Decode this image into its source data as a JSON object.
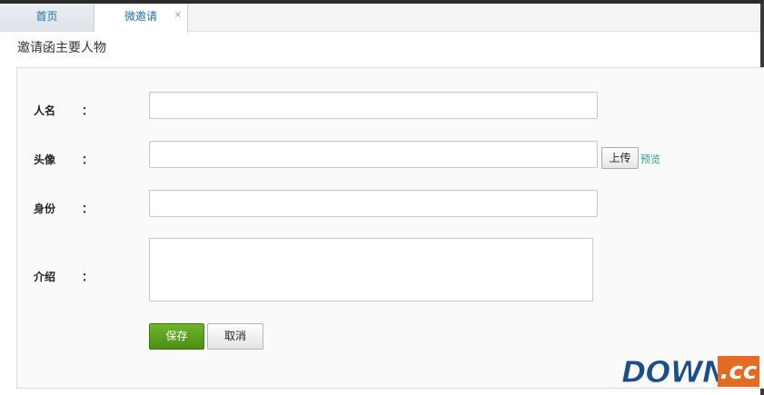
{
  "tabs": [
    {
      "label": "首页"
    },
    {
      "label": "微邀请",
      "close": "×"
    }
  ],
  "page": {
    "title": "邀请函主要人物"
  },
  "form": {
    "name": {
      "label": "人名",
      "colon": "：",
      "value": "",
      "placeholder": ""
    },
    "avatar": {
      "label": "头像",
      "colon": "：",
      "value": "",
      "upload_label": "上传",
      "preview_label": "预览"
    },
    "identity": {
      "label": "身份",
      "colon": "：",
      "value": ""
    },
    "intro": {
      "label": "介绍",
      "colon": "：",
      "value": ""
    }
  },
  "actions": {
    "save_label": "保存",
    "cancel_label": "取消"
  },
  "watermark": {
    "text_main": "DOWN",
    "text_suffix": ".cc"
  },
  "colors": {
    "accent": "#4a8f15",
    "link": "#2a9d8f",
    "tab_text": "#1f6fa8",
    "watermark_blue": "#1b4f8c",
    "watermark_orange": "#e46b23"
  }
}
